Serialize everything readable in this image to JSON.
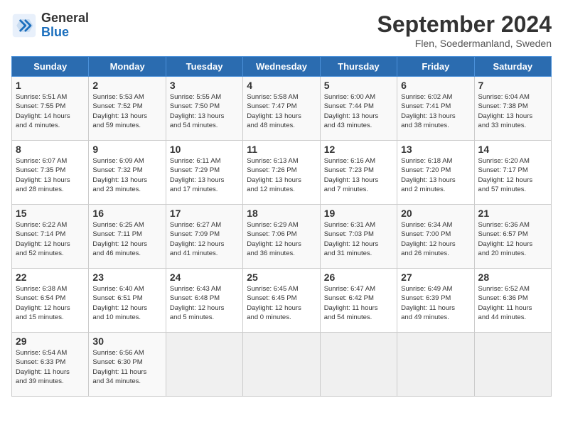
{
  "header": {
    "logo_general": "General",
    "logo_blue": "Blue",
    "title": "September 2024",
    "subtitle": "Flen, Soedermanland, Sweden"
  },
  "weekdays": [
    "Sunday",
    "Monday",
    "Tuesday",
    "Wednesday",
    "Thursday",
    "Friday",
    "Saturday"
  ],
  "weeks": [
    [
      {
        "day": "1",
        "info": "Sunrise: 5:51 AM\nSunset: 7:55 PM\nDaylight: 14 hours\nand 4 minutes."
      },
      {
        "day": "2",
        "info": "Sunrise: 5:53 AM\nSunset: 7:52 PM\nDaylight: 13 hours\nand 59 minutes."
      },
      {
        "day": "3",
        "info": "Sunrise: 5:55 AM\nSunset: 7:50 PM\nDaylight: 13 hours\nand 54 minutes."
      },
      {
        "day": "4",
        "info": "Sunrise: 5:58 AM\nSunset: 7:47 PM\nDaylight: 13 hours\nand 48 minutes."
      },
      {
        "day": "5",
        "info": "Sunrise: 6:00 AM\nSunset: 7:44 PM\nDaylight: 13 hours\nand 43 minutes."
      },
      {
        "day": "6",
        "info": "Sunrise: 6:02 AM\nSunset: 7:41 PM\nDaylight: 13 hours\nand 38 minutes."
      },
      {
        "day": "7",
        "info": "Sunrise: 6:04 AM\nSunset: 7:38 PM\nDaylight: 13 hours\nand 33 minutes."
      }
    ],
    [
      {
        "day": "8",
        "info": "Sunrise: 6:07 AM\nSunset: 7:35 PM\nDaylight: 13 hours\nand 28 minutes."
      },
      {
        "day": "9",
        "info": "Sunrise: 6:09 AM\nSunset: 7:32 PM\nDaylight: 13 hours\nand 23 minutes."
      },
      {
        "day": "10",
        "info": "Sunrise: 6:11 AM\nSunset: 7:29 PM\nDaylight: 13 hours\nand 17 minutes."
      },
      {
        "day": "11",
        "info": "Sunrise: 6:13 AM\nSunset: 7:26 PM\nDaylight: 13 hours\nand 12 minutes."
      },
      {
        "day": "12",
        "info": "Sunrise: 6:16 AM\nSunset: 7:23 PM\nDaylight: 13 hours\nand 7 minutes."
      },
      {
        "day": "13",
        "info": "Sunrise: 6:18 AM\nSunset: 7:20 PM\nDaylight: 13 hours\nand 2 minutes."
      },
      {
        "day": "14",
        "info": "Sunrise: 6:20 AM\nSunset: 7:17 PM\nDaylight: 12 hours\nand 57 minutes."
      }
    ],
    [
      {
        "day": "15",
        "info": "Sunrise: 6:22 AM\nSunset: 7:14 PM\nDaylight: 12 hours\nand 52 minutes."
      },
      {
        "day": "16",
        "info": "Sunrise: 6:25 AM\nSunset: 7:11 PM\nDaylight: 12 hours\nand 46 minutes."
      },
      {
        "day": "17",
        "info": "Sunrise: 6:27 AM\nSunset: 7:09 PM\nDaylight: 12 hours\nand 41 minutes."
      },
      {
        "day": "18",
        "info": "Sunrise: 6:29 AM\nSunset: 7:06 PM\nDaylight: 12 hours\nand 36 minutes."
      },
      {
        "day": "19",
        "info": "Sunrise: 6:31 AM\nSunset: 7:03 PM\nDaylight: 12 hours\nand 31 minutes."
      },
      {
        "day": "20",
        "info": "Sunrise: 6:34 AM\nSunset: 7:00 PM\nDaylight: 12 hours\nand 26 minutes."
      },
      {
        "day": "21",
        "info": "Sunrise: 6:36 AM\nSunset: 6:57 PM\nDaylight: 12 hours\nand 20 minutes."
      }
    ],
    [
      {
        "day": "22",
        "info": "Sunrise: 6:38 AM\nSunset: 6:54 PM\nDaylight: 12 hours\nand 15 minutes."
      },
      {
        "day": "23",
        "info": "Sunrise: 6:40 AM\nSunset: 6:51 PM\nDaylight: 12 hours\nand 10 minutes."
      },
      {
        "day": "24",
        "info": "Sunrise: 6:43 AM\nSunset: 6:48 PM\nDaylight: 12 hours\nand 5 minutes."
      },
      {
        "day": "25",
        "info": "Sunrise: 6:45 AM\nSunset: 6:45 PM\nDaylight: 12 hours\nand 0 minutes."
      },
      {
        "day": "26",
        "info": "Sunrise: 6:47 AM\nSunset: 6:42 PM\nDaylight: 11 hours\nand 54 minutes."
      },
      {
        "day": "27",
        "info": "Sunrise: 6:49 AM\nSunset: 6:39 PM\nDaylight: 11 hours\nand 49 minutes."
      },
      {
        "day": "28",
        "info": "Sunrise: 6:52 AM\nSunset: 6:36 PM\nDaylight: 11 hours\nand 44 minutes."
      }
    ],
    [
      {
        "day": "29",
        "info": "Sunrise: 6:54 AM\nSunset: 6:33 PM\nDaylight: 11 hours\nand 39 minutes."
      },
      {
        "day": "30",
        "info": "Sunrise: 6:56 AM\nSunset: 6:30 PM\nDaylight: 11 hours\nand 34 minutes."
      },
      {
        "day": "",
        "info": ""
      },
      {
        "day": "",
        "info": ""
      },
      {
        "day": "",
        "info": ""
      },
      {
        "day": "",
        "info": ""
      },
      {
        "day": "",
        "info": ""
      }
    ]
  ]
}
